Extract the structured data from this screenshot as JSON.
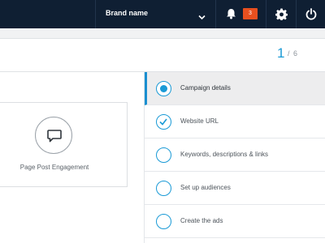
{
  "topbar": {
    "brand_label": "Brand name",
    "notification_count": "3",
    "colors": {
      "bar": "#0f1f33",
      "badge": "#e8501f"
    }
  },
  "pager": {
    "current": "1",
    "separator": "/",
    "total": "6"
  },
  "card": {
    "icon": "speech-bubble-icon",
    "label": "Page Post Engagement"
  },
  "steps": [
    {
      "label": "Campaign details",
      "state": "active"
    },
    {
      "label": "Website URL",
      "state": "completed"
    },
    {
      "label": "Keywords, descriptions & links",
      "state": "pending"
    },
    {
      "label": "Set up audiences",
      "state": "pending"
    },
    {
      "label": "Create the ads",
      "state": "pending"
    }
  ],
  "accent_color": "#1a9ad6"
}
